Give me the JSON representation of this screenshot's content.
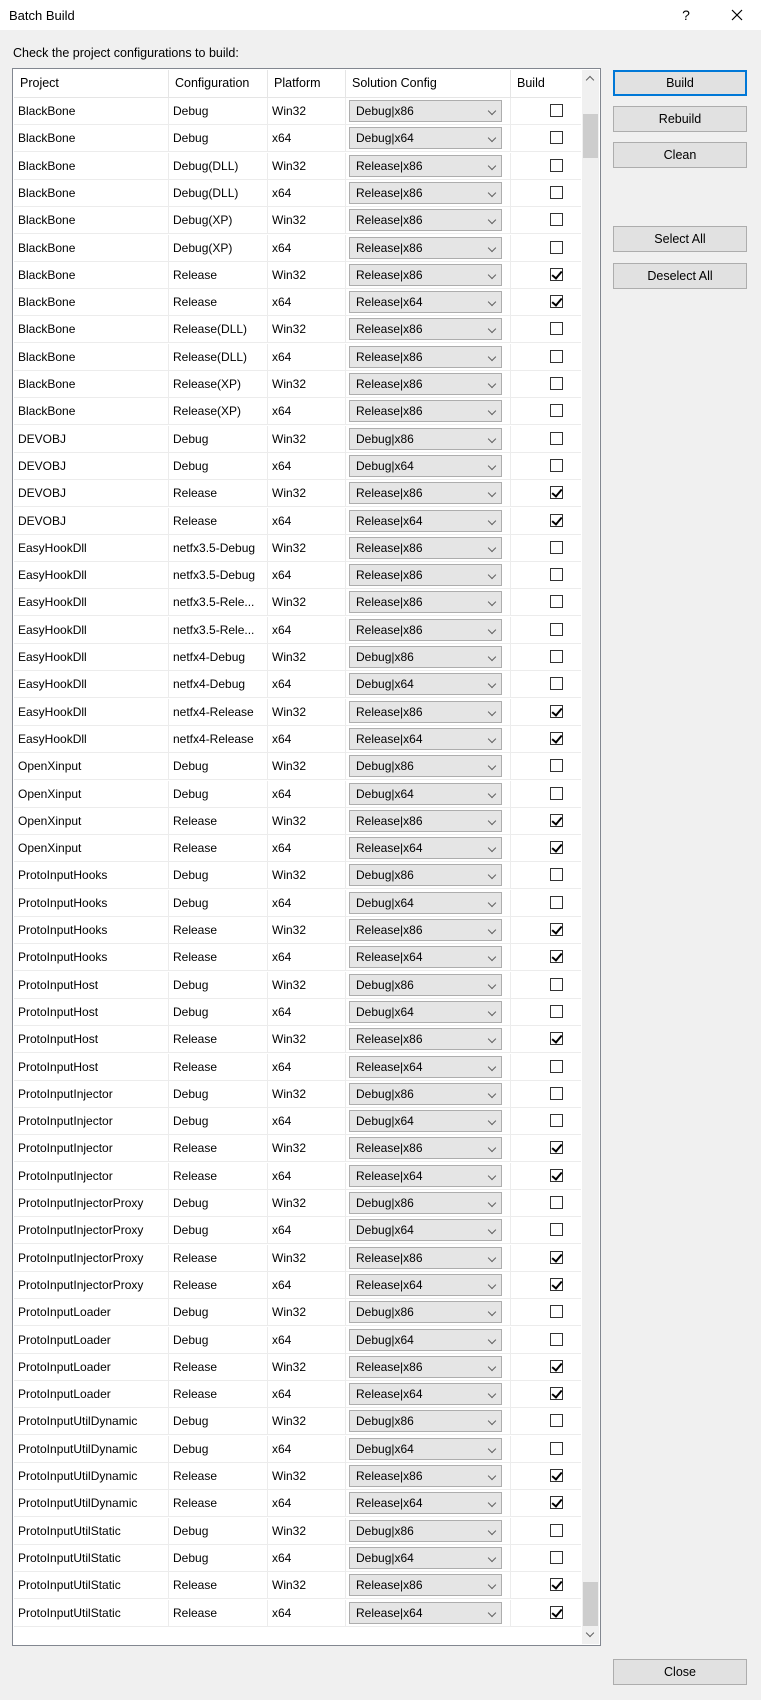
{
  "window": {
    "title": "Batch Build",
    "help": "?"
  },
  "instruction": "Check the project configurations to build:",
  "columns": [
    "Project",
    "Configuration",
    "Platform",
    "Solution Config",
    "Build"
  ],
  "rows": [
    {
      "project": "BlackBone",
      "config": "Debug",
      "platform": "Win32",
      "solution": "Debug|x86",
      "build": false
    },
    {
      "project": "BlackBone",
      "config": "Debug",
      "platform": "x64",
      "solution": "Debug|x64",
      "build": false
    },
    {
      "project": "BlackBone",
      "config": "Debug(DLL)",
      "platform": "Win32",
      "solution": "Release|x86",
      "build": false
    },
    {
      "project": "BlackBone",
      "config": "Debug(DLL)",
      "platform": "x64",
      "solution": "Release|x86",
      "build": false
    },
    {
      "project": "BlackBone",
      "config": "Debug(XP)",
      "platform": "Win32",
      "solution": "Release|x86",
      "build": false
    },
    {
      "project": "BlackBone",
      "config": "Debug(XP)",
      "platform": "x64",
      "solution": "Release|x86",
      "build": false
    },
    {
      "project": "BlackBone",
      "config": "Release",
      "platform": "Win32",
      "solution": "Release|x86",
      "build": true
    },
    {
      "project": "BlackBone",
      "config": "Release",
      "platform": "x64",
      "solution": "Release|x64",
      "build": true
    },
    {
      "project": "BlackBone",
      "config": "Release(DLL)",
      "platform": "Win32",
      "solution": "Release|x86",
      "build": false
    },
    {
      "project": "BlackBone",
      "config": "Release(DLL)",
      "platform": "x64",
      "solution": "Release|x86",
      "build": false
    },
    {
      "project": "BlackBone",
      "config": "Release(XP)",
      "platform": "Win32",
      "solution": "Release|x86",
      "build": false
    },
    {
      "project": "BlackBone",
      "config": "Release(XP)",
      "platform": "x64",
      "solution": "Release|x86",
      "build": false
    },
    {
      "project": "DEVOBJ",
      "config": "Debug",
      "platform": "Win32",
      "solution": "Debug|x86",
      "build": false
    },
    {
      "project": "DEVOBJ",
      "config": "Debug",
      "platform": "x64",
      "solution": "Debug|x64",
      "build": false
    },
    {
      "project": "DEVOBJ",
      "config": "Release",
      "platform": "Win32",
      "solution": "Release|x86",
      "build": true
    },
    {
      "project": "DEVOBJ",
      "config": "Release",
      "platform": "x64",
      "solution": "Release|x64",
      "build": true
    },
    {
      "project": "EasyHookDll",
      "config": "netfx3.5-Debug",
      "platform": "Win32",
      "solution": "Release|x86",
      "build": false
    },
    {
      "project": "EasyHookDll",
      "config": "netfx3.5-Debug",
      "platform": "x64",
      "solution": "Release|x86",
      "build": false
    },
    {
      "project": "EasyHookDll",
      "config": "netfx3.5-Rele...",
      "platform": "Win32",
      "solution": "Release|x86",
      "build": false
    },
    {
      "project": "EasyHookDll",
      "config": "netfx3.5-Rele...",
      "platform": "x64",
      "solution": "Release|x86",
      "build": false
    },
    {
      "project": "EasyHookDll",
      "config": "netfx4-Debug",
      "platform": "Win32",
      "solution": "Debug|x86",
      "build": false
    },
    {
      "project": "EasyHookDll",
      "config": "netfx4-Debug",
      "platform": "x64",
      "solution": "Debug|x64",
      "build": false
    },
    {
      "project": "EasyHookDll",
      "config": "netfx4-Release",
      "platform": "Win32",
      "solution": "Release|x86",
      "build": true
    },
    {
      "project": "EasyHookDll",
      "config": "netfx4-Release",
      "platform": "x64",
      "solution": "Release|x64",
      "build": true
    },
    {
      "project": "OpenXinput",
      "config": "Debug",
      "platform": "Win32",
      "solution": "Debug|x86",
      "build": false
    },
    {
      "project": "OpenXinput",
      "config": "Debug",
      "platform": "x64",
      "solution": "Debug|x64",
      "build": false
    },
    {
      "project": "OpenXinput",
      "config": "Release",
      "platform": "Win32",
      "solution": "Release|x86",
      "build": true
    },
    {
      "project": "OpenXinput",
      "config": "Release",
      "platform": "x64",
      "solution": "Release|x64",
      "build": true
    },
    {
      "project": "ProtoInputHooks",
      "config": "Debug",
      "platform": "Win32",
      "solution": "Debug|x86",
      "build": false
    },
    {
      "project": "ProtoInputHooks",
      "config": "Debug",
      "platform": "x64",
      "solution": "Debug|x64",
      "build": false
    },
    {
      "project": "ProtoInputHooks",
      "config": "Release",
      "platform": "Win32",
      "solution": "Release|x86",
      "build": true
    },
    {
      "project": "ProtoInputHooks",
      "config": "Release",
      "platform": "x64",
      "solution": "Release|x64",
      "build": true
    },
    {
      "project": "ProtoInputHost",
      "config": "Debug",
      "platform": "Win32",
      "solution": "Debug|x86",
      "build": false
    },
    {
      "project": "ProtoInputHost",
      "config": "Debug",
      "platform": "x64",
      "solution": "Debug|x64",
      "build": false
    },
    {
      "project": "ProtoInputHost",
      "config": "Release",
      "platform": "Win32",
      "solution": "Release|x86",
      "build": true
    },
    {
      "project": "ProtoInputHost",
      "config": "Release",
      "platform": "x64",
      "solution": "Release|x64",
      "build": false
    },
    {
      "project": "ProtoInputInjector",
      "config": "Debug",
      "platform": "Win32",
      "solution": "Debug|x86",
      "build": false
    },
    {
      "project": "ProtoInputInjector",
      "config": "Debug",
      "platform": "x64",
      "solution": "Debug|x64",
      "build": false
    },
    {
      "project": "ProtoInputInjector",
      "config": "Release",
      "platform": "Win32",
      "solution": "Release|x86",
      "build": true
    },
    {
      "project": "ProtoInputInjector",
      "config": "Release",
      "platform": "x64",
      "solution": "Release|x64",
      "build": true
    },
    {
      "project": "ProtoInputInjectorProxy",
      "config": "Debug",
      "platform": "Win32",
      "solution": "Debug|x86",
      "build": false
    },
    {
      "project": "ProtoInputInjectorProxy",
      "config": "Debug",
      "platform": "x64",
      "solution": "Debug|x64",
      "build": false
    },
    {
      "project": "ProtoInputInjectorProxy",
      "config": "Release",
      "platform": "Win32",
      "solution": "Release|x86",
      "build": true
    },
    {
      "project": "ProtoInputInjectorProxy",
      "config": "Release",
      "platform": "x64",
      "solution": "Release|x64",
      "build": true
    },
    {
      "project": "ProtoInputLoader",
      "config": "Debug",
      "platform": "Win32",
      "solution": "Debug|x86",
      "build": false
    },
    {
      "project": "ProtoInputLoader",
      "config": "Debug",
      "platform": "x64",
      "solution": "Debug|x64",
      "build": false
    },
    {
      "project": "ProtoInputLoader",
      "config": "Release",
      "platform": "Win32",
      "solution": "Release|x86",
      "build": true
    },
    {
      "project": "ProtoInputLoader",
      "config": "Release",
      "platform": "x64",
      "solution": "Release|x64",
      "build": true
    },
    {
      "project": "ProtoInputUtilDynamic",
      "config": "Debug",
      "platform": "Win32",
      "solution": "Debug|x86",
      "build": false
    },
    {
      "project": "ProtoInputUtilDynamic",
      "config": "Debug",
      "platform": "x64",
      "solution": "Debug|x64",
      "build": false
    },
    {
      "project": "ProtoInputUtilDynamic",
      "config": "Release",
      "platform": "Win32",
      "solution": "Release|x86",
      "build": true
    },
    {
      "project": "ProtoInputUtilDynamic",
      "config": "Release",
      "platform": "x64",
      "solution": "Release|x64",
      "build": true
    },
    {
      "project": "ProtoInputUtilStatic",
      "config": "Debug",
      "platform": "Win32",
      "solution": "Debug|x86",
      "build": false
    },
    {
      "project": "ProtoInputUtilStatic",
      "config": "Debug",
      "platform": "x64",
      "solution": "Debug|x64",
      "build": false
    },
    {
      "project": "ProtoInputUtilStatic",
      "config": "Release",
      "platform": "Win32",
      "solution": "Release|x86",
      "build": true
    },
    {
      "project": "ProtoInputUtilStatic",
      "config": "Release",
      "platform": "x64",
      "solution": "Release|x64",
      "build": true
    }
  ],
  "buttons": {
    "build": "Build",
    "rebuild": "Rebuild",
    "clean": "Clean",
    "select_all": "Select All",
    "deselect_all": "Deselect All",
    "close": "Close"
  },
  "icons": {
    "close": "close-icon",
    "combo_arrow": "chevron-down-icon",
    "check": "checkmark-icon"
  },
  "colors": {
    "default_button_border": "#0078d7",
    "window_bg": "#f0f0f0",
    "grid_bg": "#ffffff"
  }
}
